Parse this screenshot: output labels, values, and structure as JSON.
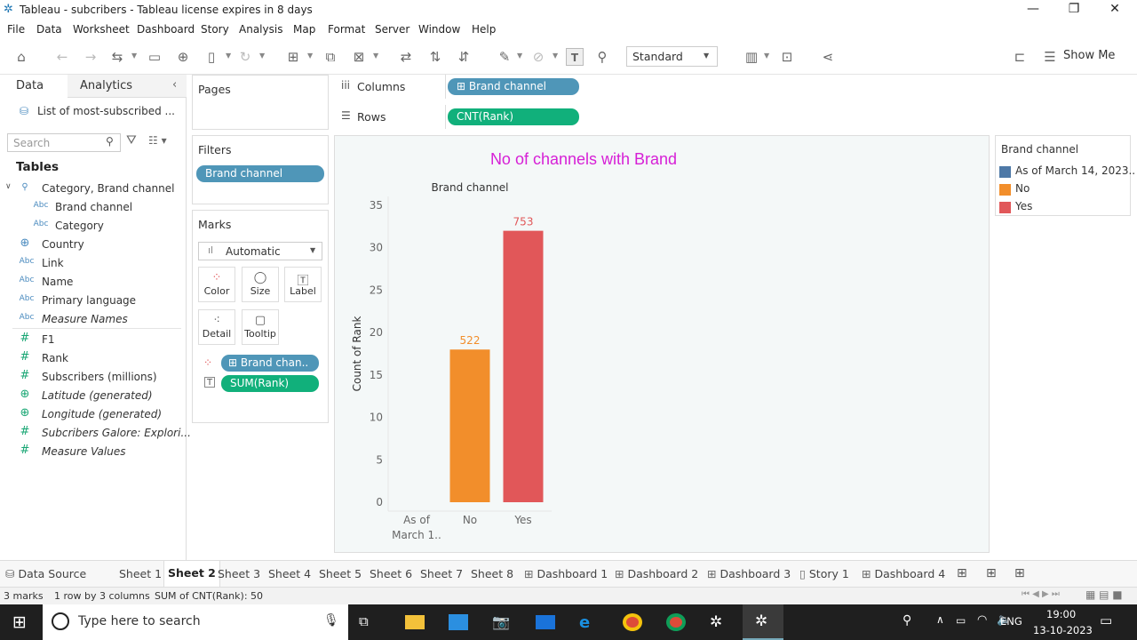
{
  "window": {
    "title": "Tableau - subcribers - Tableau license expires in 8 days",
    "controls": [
      "minimize-icon",
      "restore-icon",
      "close-icon"
    ]
  },
  "menu": [
    "File",
    "Data",
    "Worksheet",
    "Dashboard",
    "Story",
    "Analysis",
    "Map",
    "Format",
    "Server",
    "Window",
    "Help"
  ],
  "toolbar": {
    "fit_value": "Standard",
    "show_me_label": "Show Me"
  },
  "left_pane": {
    "tabs": [
      "Data",
      "Analytics"
    ],
    "datasource": "List of most-subscribed ...",
    "search_placeholder": "Search",
    "tables_heading": "Tables",
    "fields": [
      {
        "icon": "hierarchy-icon",
        "label": "Category, Brand channel",
        "italic": false
      },
      {
        "icon": "Abc",
        "label": "Brand channel",
        "italic": false
      },
      {
        "icon": "Abc",
        "label": "Category",
        "italic": false
      },
      {
        "icon": "globe-icon",
        "label": "Country",
        "italic": false
      },
      {
        "icon": "Abc",
        "label": "Link",
        "italic": false
      },
      {
        "icon": "Abc",
        "label": "Name",
        "italic": false
      },
      {
        "icon": "Abc",
        "label": "Primary language",
        "italic": false
      },
      {
        "icon": "Abc",
        "label": "Measure Names",
        "italic": true
      },
      {
        "icon": "#",
        "label": "F1",
        "italic": false
      },
      {
        "icon": "#",
        "label": "Rank",
        "italic": false
      },
      {
        "icon": "#",
        "label": "Subscribers (millions)",
        "italic": false
      },
      {
        "icon": "globe-icon",
        "label": "Latitude (generated)",
        "italic": true
      },
      {
        "icon": "globe-icon",
        "label": "Longitude (generated)",
        "italic": true
      },
      {
        "icon": "#",
        "label": "Subcribers Galore: Explori...",
        "italic": true
      },
      {
        "icon": "#",
        "label": "Measure Values",
        "italic": true
      }
    ]
  },
  "cards": {
    "pages": "Pages",
    "filters": "Filters",
    "filter_pill": "Brand channel",
    "marks": "Marks",
    "mark_type": "Automatic",
    "mark_buttons": [
      "Color",
      "Size",
      "Label",
      "Detail",
      "Tooltip"
    ],
    "marks_pills": [
      "Brand chan..",
      "SUM(Rank)"
    ]
  },
  "shelves": {
    "columns_label": "Columns",
    "columns_pill": "Brand channel",
    "rows_label": "Rows",
    "rows_pill": "CNT(Rank)"
  },
  "legend": {
    "title": "Brand channel",
    "items": [
      {
        "label": "As of March 14, 2023..",
        "color": "#4e79a7"
      },
      {
        "label": "No",
        "color": "#f28e2b"
      },
      {
        "label": "Yes",
        "color": "#e15759"
      }
    ]
  },
  "chart_data": {
    "type": "bar",
    "title": "No of channels with Brand",
    "header": "Brand channel",
    "ylabel": "Count of Rank",
    "categories": [
      "As of March 1..",
      "No",
      "Yes"
    ],
    "values": [
      0,
      18,
      32
    ],
    "data_labels": [
      "",
      "522",
      "753"
    ],
    "colors": [
      "#4e79a7",
      "#f28e2b",
      "#e15759"
    ],
    "yticks": [
      0,
      5,
      10,
      15,
      20,
      25,
      30,
      35
    ],
    "ylim": [
      0,
      35
    ],
    "grid": false
  },
  "sheet_tabs": [
    {
      "label": "Data Source",
      "icon": "database-icon",
      "active": false
    },
    {
      "label": "Sheet 1",
      "icon": "",
      "active": false
    },
    {
      "label": "Sheet 2",
      "icon": "",
      "active": true
    },
    {
      "label": "Sheet 3",
      "icon": "",
      "active": false
    },
    {
      "label": "Sheet 4",
      "icon": "",
      "active": false
    },
    {
      "label": "Sheet 5",
      "icon": "",
      "active": false
    },
    {
      "label": "Sheet 6",
      "icon": "",
      "active": false
    },
    {
      "label": "Sheet 7",
      "icon": "",
      "active": false
    },
    {
      "label": "Sheet 8",
      "icon": "",
      "active": false
    },
    {
      "label": "Dashboard 1",
      "icon": "dashboard-icon",
      "active": false
    },
    {
      "label": "Dashboard 2",
      "icon": "dashboard-icon",
      "active": false
    },
    {
      "label": "Dashboard 3",
      "icon": "dashboard-icon",
      "active": false
    },
    {
      "label": "Story 1",
      "icon": "story-icon",
      "active": false
    },
    {
      "label": "Dashboard 4",
      "icon": "dashboard-icon",
      "active": false
    }
  ],
  "status": {
    "marks": "3 marks",
    "rows_cols": "1 row by 3 columns",
    "sum": "SUM of CNT(Rank): 50"
  },
  "taskbar": {
    "search_placeholder": "Type here to search",
    "lang": "ENG",
    "time": "19:00",
    "date": "13-10-2023"
  }
}
